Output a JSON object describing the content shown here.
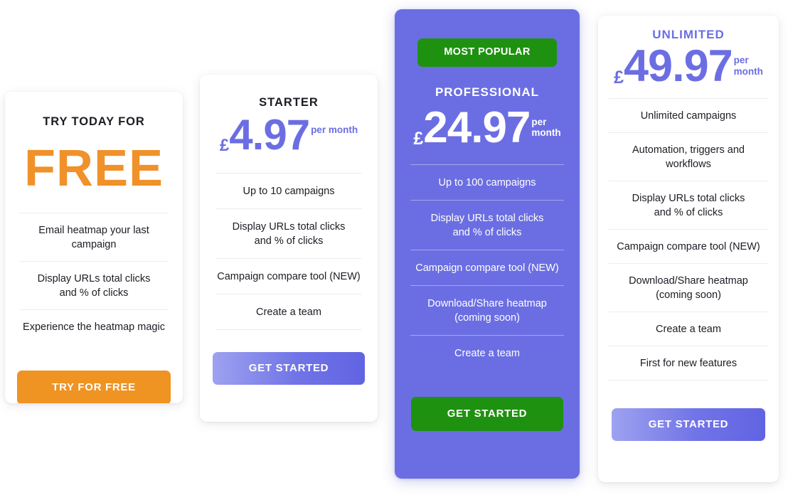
{
  "theme": {
    "accent_purple": "#6b6ee2",
    "accent_orange": "#ef9322",
    "accent_green": "#1f9111",
    "card_background": "#ffffff",
    "featured_card_background": "#6b6ee2",
    "page_background": "#ffffff",
    "divider": "#eeeef1"
  },
  "plans": [
    {
      "id": "free",
      "eyebrow": "TRY TODAY FOR",
      "headline": "FREE",
      "features": [
        "Email heatmap your last campaign",
        "Display URLs total clicks\nand % of clicks",
        "Experience the heatmap magic"
      ],
      "cta_label": "TRY FOR FREE"
    },
    {
      "id": "starter",
      "name": "STARTER",
      "price": {
        "currency": "£",
        "amount": "4.97",
        "period": "per month"
      },
      "features": [
        "Up to 10 campaigns",
        "Display URLs total clicks\nand % of clicks",
        "Campaign compare tool (NEW)",
        "Create a team"
      ],
      "cta_label": "GET STARTED"
    },
    {
      "id": "professional",
      "badge": "MOST POPULAR",
      "name": "PROFESSIONAL",
      "price": {
        "currency": "£",
        "amount": "24.97",
        "period_line1": "per",
        "period_line2": "month"
      },
      "features": [
        "Up to 100 campaigns",
        "Display URLs total clicks\nand % of clicks",
        "Campaign compare tool (NEW)",
        "Download/Share heatmap\n(coming soon)",
        "Create a team"
      ],
      "cta_label": "GET STARTED"
    },
    {
      "id": "unlimited",
      "name": "UNLIMITED",
      "price": {
        "currency": "£",
        "amount": "49.97",
        "period_line1": "per",
        "period_line2": "month"
      },
      "features": [
        "Unlimited campaigns",
        "Automation, triggers and workflows",
        "Display URLs total clicks\nand % of clicks",
        "Campaign compare tool (NEW)",
        "Download/Share heatmap\n(coming soon)",
        "Create a team",
        "First for new features"
      ],
      "cta_label": "GET STARTED"
    }
  ]
}
